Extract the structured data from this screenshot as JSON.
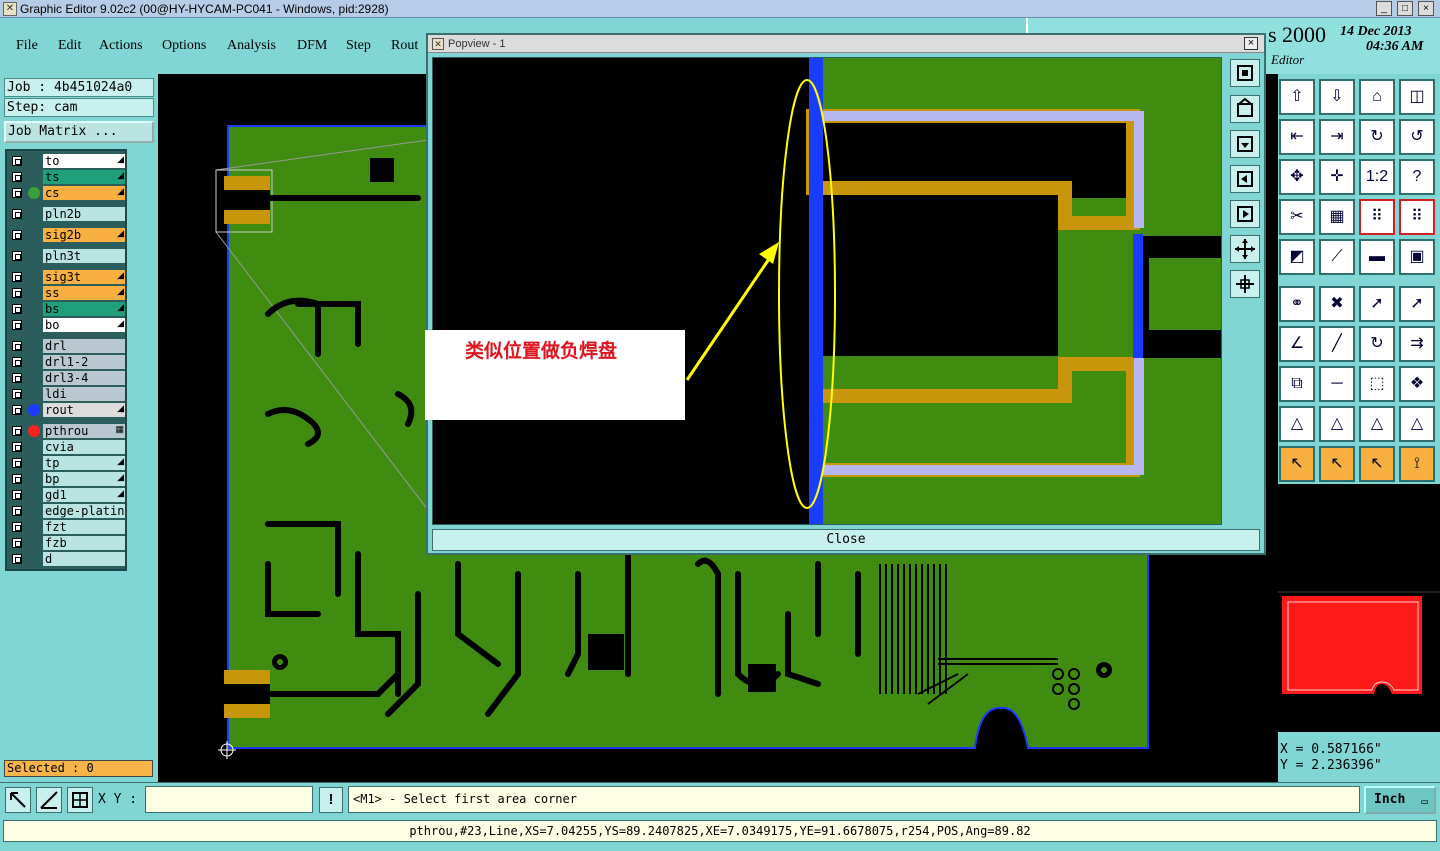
{
  "window": {
    "title": "Graphic Editor 9.02c2 (00@HY-HYCAM-PC041 - Windows, pid:2928)",
    "controls": [
      "_",
      "□",
      "×"
    ]
  },
  "menu": [
    "File",
    "Edit",
    "Actions",
    "Options",
    "Analysis",
    "DFM",
    "Step",
    "Rout"
  ],
  "brand": {
    "product": "s 2000",
    "subtitle": "Editor",
    "date": "14 Dec 2013",
    "time": "04:36 AM"
  },
  "job": {
    "job_label": "Job : 4b451024a0",
    "step_label": "Step: cam",
    "matrix_button": "Job Matrix ..."
  },
  "layers": [
    {
      "name": "to",
      "bg": "#ffffff",
      "dot": "",
      "act": "◢"
    },
    {
      "name": "ts",
      "bg": "#1fa07a",
      "dot": "",
      "act": "◢"
    },
    {
      "name": "cs",
      "bg": "#f8b040",
      "dot": "#3aa03a",
      "act": "◢"
    },
    {
      "name": "pln2b",
      "bg": "#b9e4e2",
      "dot": "",
      "act": ""
    },
    {
      "name": "sig2b",
      "bg": "#f8b040",
      "dot": "",
      "act": "◢"
    },
    {
      "name": "pln3t",
      "bg": "#b9e4e2",
      "dot": "",
      "act": ""
    },
    {
      "name": "sig3t",
      "bg": "#f8b040",
      "dot": "",
      "act": "◢"
    },
    {
      "name": "ss",
      "bg": "#f8b040",
      "dot": "",
      "act": "◢"
    },
    {
      "name": "bs",
      "bg": "#1fa07a",
      "dot": "",
      "act": "◢"
    },
    {
      "name": "bo",
      "bg": "#ffffff",
      "dot": "",
      "act": "◢"
    },
    {
      "name": "drl",
      "bg": "#b9c8d0",
      "dot": "",
      "act": ""
    },
    {
      "name": "drl1-2",
      "bg": "#b9c8d0",
      "dot": "",
      "act": ""
    },
    {
      "name": "drl3-4",
      "bg": "#b9c8d0",
      "dot": "",
      "act": ""
    },
    {
      "name": "ldi",
      "bg": "#b9c8d0",
      "dot": "",
      "act": ""
    },
    {
      "name": "rout",
      "bg": "#dcdcdc",
      "dot": "#1a3cff",
      "act": "◢"
    },
    {
      "name": "pthrou",
      "bg": "#b9c8d0",
      "dot": "#ff2020",
      "act": "▦"
    },
    {
      "name": "cvia",
      "bg": "#b9e4e2",
      "dot": "",
      "act": ""
    },
    {
      "name": "tp",
      "bg": "#b9e4e2",
      "dot": "",
      "act": "◢"
    },
    {
      "name": "bp",
      "bg": "#b9e4e2",
      "dot": "",
      "act": "◢"
    },
    {
      "name": "gd1",
      "bg": "#b9e4e2",
      "dot": "",
      "act": "◢"
    },
    {
      "name": "edge-plating",
      "bg": "#b9e4e2",
      "dot": "",
      "act": ""
    },
    {
      "name": "fzt",
      "bg": "#b9e4e2",
      "dot": "",
      "act": ""
    },
    {
      "name": "fzb",
      "bg": "#b9e4e2",
      "dot": "",
      "act": ""
    },
    {
      "name": "d",
      "bg": "#b9e4e2",
      "dot": "",
      "act": ""
    }
  ],
  "selected": "Selected : 0",
  "popup": {
    "title": "Popview - 1",
    "close_label": "Close",
    "annotation": "类似位置做负焊盘"
  },
  "coords": {
    "x": "X = 0.587166\"",
    "y": "Y = 2.236396\""
  },
  "command": {
    "xy_label": "X Y :",
    "xy_value": "",
    "prompt": "<M1> - Select first area corner",
    "units": "Inch"
  },
  "status_line": "pthrou,#23,Line,XS=7.04255,YS=89.2407825,XE=7.0349175,YE=91.6678075,r254,POS,Ang=89.82",
  "colors": {
    "board_green": "#3f8c10",
    "panel_teal": "#7fd6d4",
    "trace_orange": "#c8960c",
    "rout_blue": "#1a3cff",
    "annotation_red": "#e0141e"
  }
}
